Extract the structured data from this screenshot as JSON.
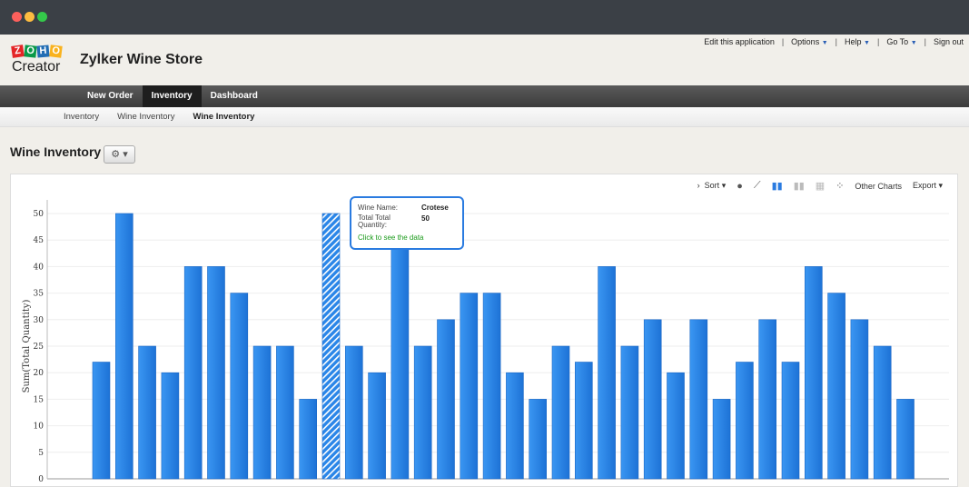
{
  "app": {
    "logo_text": "ZOHO",
    "logo_sub": "Creator",
    "title": "Zylker Wine Store"
  },
  "toplinks": [
    "Edit this application",
    "Options",
    "Help",
    "Go To",
    "Sign out"
  ],
  "nav": [
    "New Order",
    "Inventory",
    "Dashboard"
  ],
  "subnav": [
    "Inventory",
    "Wine Inventory",
    "Wine Inventory"
  ],
  "page": {
    "title": "Wine Inventory",
    "gear": "gear-icon"
  },
  "toolbar": {
    "sort": "Sort",
    "other_charts": "Other Charts",
    "export": "Export"
  },
  "tooltip": {
    "name_label": "Wine Name:",
    "name_value": "Crotese",
    "qty_label": "Total Total Quantity:",
    "qty_value": "50",
    "link": "Click to see the data"
  },
  "chart_data": {
    "type": "bar",
    "ylabel": "Sum(Total Quantity)",
    "ylim": [
      0,
      50
    ],
    "yticks": [
      0,
      5,
      10,
      15,
      20,
      25,
      30,
      35,
      40,
      45,
      50
    ],
    "grid": true,
    "bar_color": "#2a86e8",
    "highlighted_index": 10,
    "values": [
      22,
      50,
      25,
      20,
      40,
      40,
      35,
      25,
      25,
      15,
      50,
      25,
      20,
      45,
      25,
      30,
      35,
      35,
      20,
      15,
      25,
      22,
      40,
      25,
      30,
      20,
      30,
      15,
      22,
      30,
      22,
      40,
      35,
      30,
      25,
      15
    ]
  }
}
